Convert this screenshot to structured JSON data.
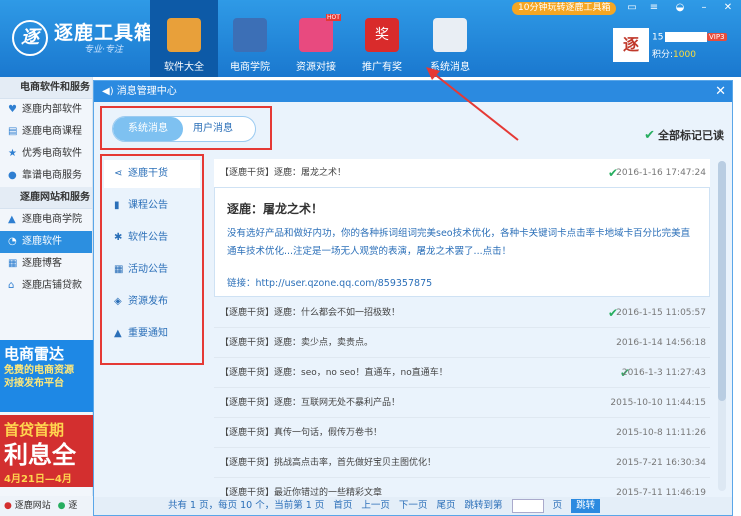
{
  "app": {
    "title": "逐鹿工具箱",
    "slogan": "专业·专注",
    "logo_text": "逐"
  },
  "nav": [
    {
      "label": "软件大全",
      "color": "#e8a03a"
    },
    {
      "label": "电商学院",
      "color": "#3c6fb6"
    },
    {
      "label": "资源对接",
      "color": "#e84a7f"
    },
    {
      "label": "推广有奖",
      "color": "#d92b2b"
    },
    {
      "label": "系统消息",
      "color": "#e9eef4"
    }
  ],
  "nav_badges": {
    "hot": "HOT",
    "reward": "奖"
  },
  "promo": "10分钟玩转逐鹿工具箱",
  "user": {
    "id_prefix": "15",
    "vip": "VIP3",
    "points_label": "积分:",
    "points": "1000",
    "avatar_text": "逐"
  },
  "sidebar": {
    "sections": [
      {
        "head": "电商软件和服务",
        "items": [
          "逐鹿内部软件",
          "逐鹿电商课程",
          "优秀电商软件",
          "靠谱电商服务"
        ]
      },
      {
        "head": "逐鹿网站和服务",
        "items": [
          "逐鹿电商学院",
          "逐鹿软件",
          "逐鹿博客",
          "逐鹿店铺贷款"
        ]
      }
    ],
    "active": "逐鹿软件"
  },
  "ads": {
    "ad1": {
      "title": "电商雷达",
      "line1": "免费的电商资源",
      "line2": "对接发布平台"
    },
    "ad2": {
      "line1": "首贷首期",
      "line2": "利息全",
      "line3": "4月21日—4月"
    }
  },
  "bottom": {
    "site": "逐鹿网站",
    "more": "逐"
  },
  "panel": {
    "title": "消息管理中心",
    "tabs": [
      "系统消息",
      "用户消息"
    ],
    "mark_all": "全部标记已读",
    "categories": [
      "逐鹿干货",
      "课程公告",
      "软件公告",
      "活动公告",
      "资源发布",
      "重要通知"
    ],
    "messages": [
      {
        "text": "【逐鹿干货】逐鹿：屠龙之术！",
        "date": "2016-1-16 17:47:24",
        "read": true
      },
      {
        "text": "【逐鹿干货】逐鹿：什么都会不如一招极致！",
        "date": "2016-1-15 11:05:57",
        "read": true
      },
      {
        "text": "【逐鹿干货】逐鹿：卖少点，卖贵点。",
        "date": "2016-1-14 14:56:18",
        "read": false
      },
      {
        "text": "【逐鹿干货】逐鹿：seo，no seo！直通车，no直通车！",
        "date": "2016-1-3 11:27:43",
        "read": true
      },
      {
        "text": "【逐鹿干货】逐鹿：互联网无处不暴利产品！",
        "date": "2015-10-10 11:44:15",
        "read": false
      },
      {
        "text": "【逐鹿干货】真传一句话，假传万卷书！",
        "date": "2015-10-8 11:11:26",
        "read": false
      },
      {
        "text": "【逐鹿干货】挑战高点击率，首先做好宝贝主图优化！",
        "date": "2015-7-21 16:30:34",
        "read": false
      },
      {
        "text": "【逐鹿干货】最近你错过的一些精彩文章",
        "date": "2015-7-11 11:46:19",
        "read": false
      }
    ],
    "expanded": {
      "title": "逐鹿：屠龙之术！",
      "body": "没有选好产品和做好内功，你的各种拆词组词完美seo技术优化，各种卡关键词卡点击率卡地域卡百分比完美直通车技术优化...注定是一场无人观赏的表演，屠龙之术罢了...点击！",
      "link": "链接：http://user.qzone.qq.com/859357875"
    },
    "pager": {
      "summary": "共有 1 页，每页 10 个，当前第 1 页",
      "first": "首页",
      "prev": "上一页",
      "next": "下一页",
      "last": "尾页",
      "jump_label": "跳转到第",
      "page_unit": "页",
      "go": "跳转"
    }
  },
  "colors": {
    "accent": "#2b8ae0",
    "highlight": "#e53935",
    "read_check": "#27ae60"
  }
}
